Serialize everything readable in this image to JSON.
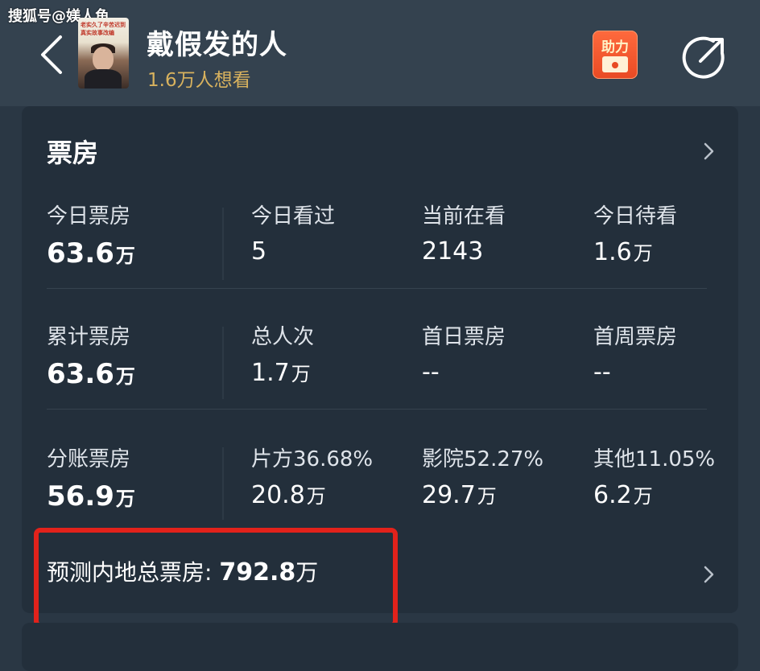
{
  "watermark": "搜狐号@媄人鱼",
  "header": {
    "movie_title": "戴假发的人",
    "want_count": "1.6万人想看",
    "poster_text_line1": "老实久了辛苦迟到",
    "poster_text_line2": "真实故事改编",
    "boost_label": "助力",
    "icons": {
      "back": "chevron-left-icon",
      "share": "share-icon"
    }
  },
  "box_office": {
    "title": "票房",
    "rows": [
      [
        {
          "label": "今日票房",
          "value": "63.6",
          "unit": "万"
        },
        {
          "label": "今日看过",
          "value": "5",
          "unit": ""
        },
        {
          "label": "当前在看",
          "value": "2143",
          "unit": ""
        },
        {
          "label": "今日待看",
          "value": "1.6",
          "unit": "万"
        }
      ],
      [
        {
          "label": "累计票房",
          "value": "63.6",
          "unit": "万"
        },
        {
          "label": "总人次",
          "value": "1.7",
          "unit": "万"
        },
        {
          "label": "首日票房",
          "value": "--",
          "unit": ""
        },
        {
          "label": "首周票房",
          "value": "--",
          "unit": ""
        }
      ],
      [
        {
          "label": "分账票房",
          "value": "56.9",
          "unit": "万"
        },
        {
          "label": "片方36.68%",
          "value": "20.8",
          "unit": "万"
        },
        {
          "label": "影院52.27%",
          "value": "29.7",
          "unit": "万"
        },
        {
          "label": "其他11.05%",
          "value": "6.2",
          "unit": "万"
        }
      ]
    ],
    "forecast_label": "预测内地总票房:",
    "forecast_value": "792.8",
    "forecast_unit": "万"
  },
  "next_section": {
    "title_partial": ""
  },
  "colors": {
    "background": "#2a3744",
    "card": "#232f3b",
    "accent_gold": "#d8b25e",
    "boost_orange": "#e84a24",
    "highlight_red": "#e2221b"
  }
}
